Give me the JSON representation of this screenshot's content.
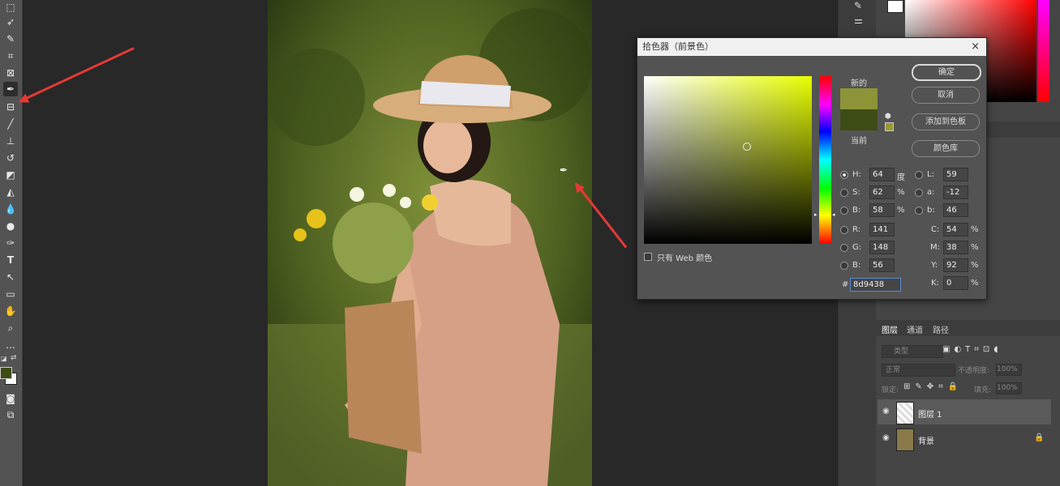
{
  "colors": {
    "new": "#8d9438",
    "current": "#3e4c15",
    "accent": "#e53935"
  },
  "picker": {
    "title": "拾色器（前景色）",
    "close": "×",
    "new_label": "新的",
    "current_label": "当前",
    "web_only": "只有 Web 颜色",
    "buttons": {
      "ok": "确定",
      "cancel": "取消",
      "add_swatch": "添加到色板",
      "libraries": "颜色库"
    },
    "fields": {
      "H": {
        "label": "H:",
        "value": "64",
        "unit": "度"
      },
      "S": {
        "label": "S:",
        "value": "62",
        "unit": "%"
      },
      "B": {
        "label": "B:",
        "value": "58",
        "unit": "%"
      },
      "R": {
        "label": "R:",
        "value": "141"
      },
      "G": {
        "label": "G:",
        "value": "148"
      },
      "Bl": {
        "label": "B:",
        "value": "56"
      },
      "L": {
        "label": "L:",
        "value": "59"
      },
      "a": {
        "label": "a:",
        "value": "-12"
      },
      "b": {
        "label": "b:",
        "value": "46"
      },
      "C": {
        "label": "C:",
        "value": "54",
        "unit": "%"
      },
      "M": {
        "label": "M:",
        "value": "38",
        "unit": "%"
      },
      "Y": {
        "label": "Y:",
        "value": "92",
        "unit": "%"
      },
      "K": {
        "label": "K:",
        "value": "0",
        "unit": "%"
      },
      "hex_label": "#",
      "hex": "8d9438"
    }
  },
  "layers_panel": {
    "tabs": [
      "图层",
      "通道",
      "路径"
    ],
    "filter_placeholder": "类型",
    "blend_mode": "正常",
    "opacity_label": "不透明度:",
    "opacity": "100%",
    "lock_label": "锁定:",
    "fill_label": "填充:",
    "fill": "100%",
    "layers": [
      {
        "name": "图层 1"
      },
      {
        "name": "背景"
      }
    ]
  }
}
